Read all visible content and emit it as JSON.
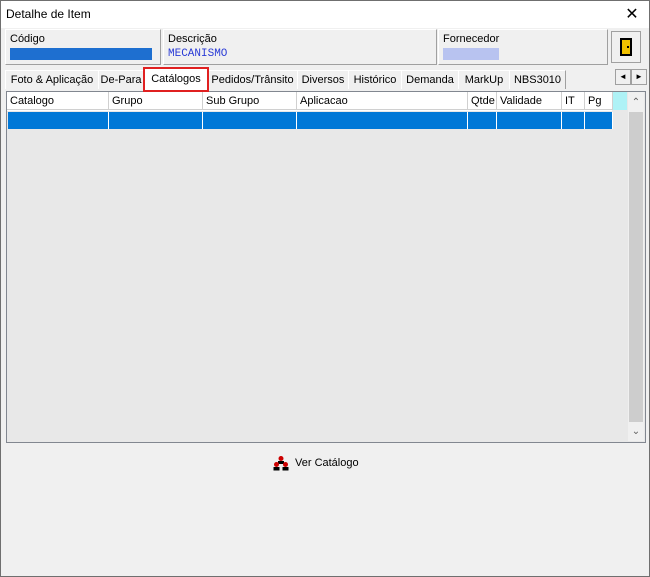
{
  "window": {
    "title": "Detalhe de Item",
    "close_glyph": "✕"
  },
  "header": {
    "codigo_label": "Código",
    "descricao_label": "Descrição",
    "descricao_value": "MECANISMO",
    "fornecedor_label": "Fornecedor"
  },
  "tabs": [
    {
      "label": "Foto & Aplicação"
    },
    {
      "label": "De-Para"
    },
    {
      "label": "Catálogos"
    },
    {
      "label": "Pedidos/Trânsito"
    },
    {
      "label": "Diversos"
    },
    {
      "label": "Histórico"
    },
    {
      "label": "Demanda"
    },
    {
      "label": "MarkUp"
    },
    {
      "label": "NBS3010"
    }
  ],
  "active_tab": "Catálogos",
  "grid": {
    "columns": [
      "Catalogo",
      "Grupo",
      "Sub Grupo",
      "Aplicacao",
      "Qtde",
      "Validade",
      "IT",
      "Pg"
    ],
    "scroll_up": "⌃",
    "scroll_down": "⌄"
  },
  "actions": {
    "ver_catalogo_label": "Ver Catálogo"
  },
  "icons": {
    "exit": "exit-door-icon",
    "catalog": "people-icon",
    "tab_left": "◄",
    "tab_right": "►"
  },
  "colors": {
    "accent": "#0078d7",
    "active_tab_border": "#e02020"
  }
}
